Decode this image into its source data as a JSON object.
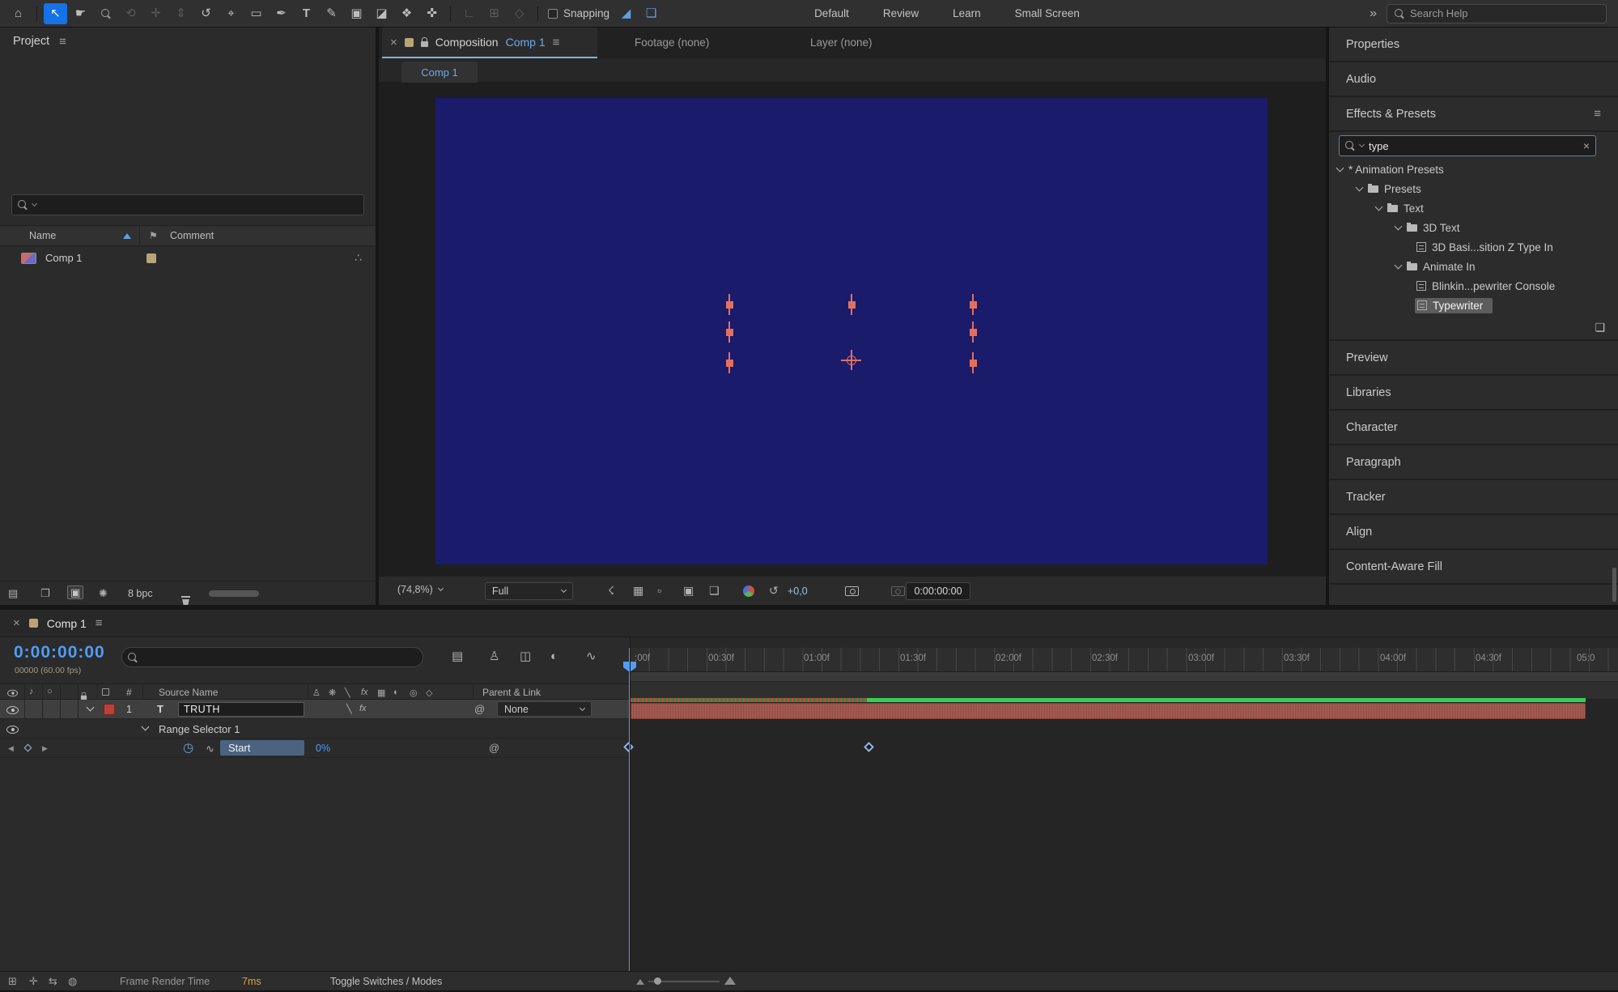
{
  "toolbar": {
    "tools": [
      {
        "name": "home",
        "glyph": "⌂"
      },
      {
        "name": "selection",
        "glyph": "↖"
      },
      {
        "name": "hand",
        "glyph": "☛"
      },
      {
        "name": "zoom",
        "glyph": ""
      },
      {
        "name": "orbit-camera",
        "glyph": "⟲"
      },
      {
        "name": "pan-camera",
        "glyph": "✛"
      },
      {
        "name": "dolly-camera",
        "glyph": "⇕"
      },
      {
        "name": "rotation",
        "glyph": "↺"
      },
      {
        "name": "pan-behind",
        "glyph": "⌖"
      },
      {
        "name": "shape",
        "glyph": "▭"
      },
      {
        "name": "pen",
        "glyph": "✒"
      },
      {
        "name": "type",
        "glyph": "T"
      },
      {
        "name": "brush",
        "glyph": "✎"
      },
      {
        "name": "clone-stamp",
        "glyph": "▣"
      },
      {
        "name": "eraser",
        "glyph": "◪"
      },
      {
        "name": "roto-brush",
        "glyph": "❖"
      },
      {
        "name": "puppet",
        "glyph": "✜"
      },
      {
        "name": "local-axis",
        "glyph": "∟"
      },
      {
        "name": "world-axis",
        "glyph": "⊞"
      },
      {
        "name": "view-axis",
        "glyph": "◇"
      }
    ],
    "snapping_label": "Snapping",
    "snap_icon_1": "◢",
    "snap_icon_2": "❏",
    "workspaces": [
      "Default",
      "Review",
      "Learn",
      "Small Screen"
    ],
    "overflow_chevron": "»",
    "search_placeholder": "Search Help"
  },
  "project": {
    "title": "Project",
    "menu_icon": "≡",
    "name_column": "Name",
    "comment_column": "Comment",
    "rows": [
      {
        "name": "Comp 1"
      }
    ],
    "flowchart_icon": "∴",
    "footer": {
      "icons": [
        {
          "name": "list-view",
          "glyph": "▤"
        },
        {
          "name": "new-folder",
          "glyph": "❐"
        },
        {
          "name": "new-composition",
          "glyph": "▣"
        },
        {
          "name": "interpret-footage",
          "glyph": "✺"
        }
      ],
      "bpc_label": "8 bpc"
    }
  },
  "viewer": {
    "close_icon": "×",
    "tab_prefix": "Composition",
    "tab_comp": "Comp 1",
    "menu_icon": "≡",
    "tab_footage": "Footage (none)",
    "tab_layer": "Layer (none)",
    "viewer_tab": "Comp 1",
    "footer": {
      "zoom_value": "(74,8%)",
      "resolution": "Full",
      "icons": [
        {
          "name": "fast-previews",
          "glyph": "☇"
        },
        {
          "name": "transparency-grid",
          "glyph": "▦"
        },
        {
          "name": "mask-visibility",
          "glyph": "▫"
        },
        {
          "name": "region-of-interest",
          "glyph": "▣"
        },
        {
          "name": "guides",
          "glyph": "❏"
        }
      ],
      "reset_icon": "↺",
      "exposure_value": "+0,0",
      "timecode": "0:00:00:00"
    }
  },
  "right_panel": {
    "stack_top": [
      "Properties",
      "Audio"
    ],
    "effects": {
      "title": "Effects & Presets",
      "menu_icon": "≡",
      "search_value": "type",
      "clear_icon": "×",
      "tree": [
        {
          "label": "* Animation Presets"
        },
        {
          "label": "Presets"
        },
        {
          "label": "Text"
        },
        {
          "label": "3D Text"
        },
        {
          "label": "3D Basi...sition Z Type In"
        },
        {
          "label": "Animate In"
        },
        {
          "label": "Blinkin...pewriter Console"
        },
        {
          "label": "Typewriter"
        }
      ],
      "new_preset_icon": "❏"
    },
    "stack_bottom": [
      "Preview",
      "Libraries",
      "Character",
      "Paragraph",
      "Tracker",
      "Align",
      "Content-Aware Fill"
    ]
  },
  "timeline": {
    "close_icon": "×",
    "tab": "Comp 1",
    "menu_icon": "≡",
    "timecode": "0:00:00:00",
    "frame_info": "00000 (60.00 fps)",
    "toolbar_icons": [
      {
        "name": "mini-flowchart",
        "glyph": "▤"
      },
      {
        "name": "shy-layers",
        "glyph": "♙"
      },
      {
        "name": "frame-blending",
        "glyph": "◫"
      },
      {
        "name": "motion-blur",
        "glyph": "◐"
      },
      {
        "name": "graph-editor",
        "glyph": "∿"
      }
    ],
    "audio_icon": "♪",
    "solo_icon": "○",
    "index_column": "#",
    "source_column": "Source Name",
    "parent_column": "Parent & Link",
    "switch_icons": [
      "♙",
      "❋",
      "╲",
      "fx",
      "▦",
      "◐",
      "◎",
      "◇"
    ],
    "layer": {
      "index": "1",
      "type_glyph": "T",
      "name": "TRUTH",
      "quality_glyph": "╲",
      "fx_glyph": "fx",
      "pickwhip": "@",
      "parent_value": "None"
    },
    "range_selector": "Range Selector 1",
    "property": {
      "stopwatch_icon": "◷",
      "graph_icon": "∿",
      "name": "Start",
      "value": "0%",
      "pickwhip": "@"
    },
    "nav": {
      "prev": "◀",
      "next": "▶"
    },
    "ruler_labels": [
      ":00f",
      "00:30f",
      "01:00f",
      "01:30f",
      "02:00f",
      "02:30f",
      "03:00f",
      "03:30f",
      "04:00f",
      "04:30f",
      "05:0"
    ],
    "footer": {
      "icons": [
        "⊞",
        "✛",
        "⇆",
        "◍"
      ],
      "render_time_label": "Frame Render Time",
      "render_time_value": "7ms",
      "toggle_label": "Toggle Switches / Modes"
    }
  }
}
